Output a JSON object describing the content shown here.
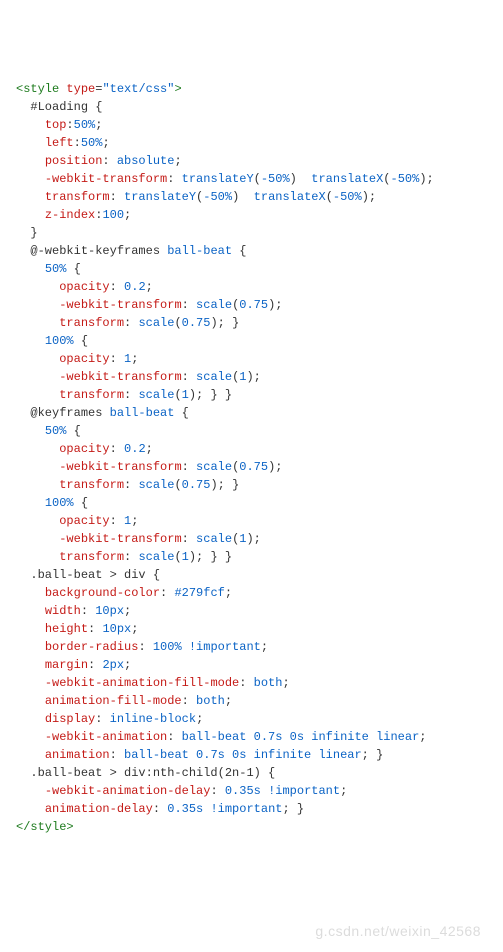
{
  "watermark": "g.csdn.net/weixin_42568",
  "code": [
    [
      {
        "t": "<style",
        "c": "tag"
      },
      {
        "t": " ",
        "c": "punct"
      },
      {
        "t": "type",
        "c": "attr"
      },
      {
        "t": "=",
        "c": "punct"
      },
      {
        "t": "\"text/css\"",
        "c": "string"
      },
      {
        "t": ">",
        "c": "tag"
      }
    ],
    [
      {
        "t": "  ",
        "c": "punct"
      },
      {
        "t": "#Loading",
        "c": "sel"
      },
      {
        "t": " {",
        "c": "punct"
      }
    ],
    [
      {
        "t": "    ",
        "c": "punct"
      },
      {
        "t": "top",
        "c": "prop"
      },
      {
        "t": ":",
        "c": "punct"
      },
      {
        "t": "50%",
        "c": "val"
      },
      {
        "t": ";",
        "c": "punct"
      }
    ],
    [
      {
        "t": "    ",
        "c": "punct"
      },
      {
        "t": "left",
        "c": "prop"
      },
      {
        "t": ":",
        "c": "punct"
      },
      {
        "t": "50%",
        "c": "val"
      },
      {
        "t": ";",
        "c": "punct"
      }
    ],
    [
      {
        "t": "    ",
        "c": "punct"
      },
      {
        "t": "position",
        "c": "prop"
      },
      {
        "t": ": ",
        "c": "punct"
      },
      {
        "t": "absolute",
        "c": "val"
      },
      {
        "t": ";",
        "c": "punct"
      }
    ],
    [
      {
        "t": "    ",
        "c": "punct"
      },
      {
        "t": "-webkit-transform",
        "c": "prop"
      },
      {
        "t": ": ",
        "c": "punct"
      },
      {
        "t": "translateY",
        "c": "val"
      },
      {
        "t": "(",
        "c": "punct"
      },
      {
        "t": "-50%",
        "c": "num"
      },
      {
        "t": ")  ",
        "c": "punct"
      },
      {
        "t": "translateX",
        "c": "val"
      },
      {
        "t": "(",
        "c": "punct"
      },
      {
        "t": "-50%",
        "c": "num"
      },
      {
        "t": ");",
        "c": "punct"
      }
    ],
    [
      {
        "t": "    ",
        "c": "punct"
      },
      {
        "t": "transform",
        "c": "prop"
      },
      {
        "t": ": ",
        "c": "punct"
      },
      {
        "t": "translateY",
        "c": "val"
      },
      {
        "t": "(",
        "c": "punct"
      },
      {
        "t": "-50%",
        "c": "num"
      },
      {
        "t": ")  ",
        "c": "punct"
      },
      {
        "t": "translateX",
        "c": "val"
      },
      {
        "t": "(",
        "c": "punct"
      },
      {
        "t": "-50%",
        "c": "num"
      },
      {
        "t": ");",
        "c": "punct"
      }
    ],
    [
      {
        "t": "    ",
        "c": "punct"
      },
      {
        "t": "z-index",
        "c": "prop"
      },
      {
        "t": ":",
        "c": "punct"
      },
      {
        "t": "100",
        "c": "val"
      },
      {
        "t": ";",
        "c": "punct"
      }
    ],
    [
      {
        "t": "  }",
        "c": "punct"
      }
    ],
    [
      {
        "t": "  ",
        "c": "punct"
      },
      {
        "t": "@-webkit-keyframes",
        "c": "sel"
      },
      {
        "t": " ",
        "c": "punct"
      },
      {
        "t": "ball-beat",
        "c": "val"
      },
      {
        "t": " {",
        "c": "punct"
      }
    ],
    [
      {
        "t": "    ",
        "c": "punct"
      },
      {
        "t": "50%",
        "c": "pct"
      },
      {
        "t": " {",
        "c": "punct"
      }
    ],
    [
      {
        "t": "      ",
        "c": "punct"
      },
      {
        "t": "opacity",
        "c": "prop"
      },
      {
        "t": ": ",
        "c": "punct"
      },
      {
        "t": "0.2",
        "c": "val"
      },
      {
        "t": ";",
        "c": "punct"
      }
    ],
    [
      {
        "t": "      ",
        "c": "punct"
      },
      {
        "t": "-webkit-transform",
        "c": "prop"
      },
      {
        "t": ": ",
        "c": "punct"
      },
      {
        "t": "scale",
        "c": "val"
      },
      {
        "t": "(",
        "c": "punct"
      },
      {
        "t": "0.75",
        "c": "num"
      },
      {
        "t": ");",
        "c": "punct"
      }
    ],
    [
      {
        "t": "      ",
        "c": "punct"
      },
      {
        "t": "transform",
        "c": "prop"
      },
      {
        "t": ": ",
        "c": "punct"
      },
      {
        "t": "scale",
        "c": "val"
      },
      {
        "t": "(",
        "c": "punct"
      },
      {
        "t": "0.75",
        "c": "num"
      },
      {
        "t": "); }",
        "c": "punct"
      }
    ],
    [
      {
        "t": "    ",
        "c": "punct"
      },
      {
        "t": "100%",
        "c": "pct"
      },
      {
        "t": " {",
        "c": "punct"
      }
    ],
    [
      {
        "t": "      ",
        "c": "punct"
      },
      {
        "t": "opacity",
        "c": "prop"
      },
      {
        "t": ": ",
        "c": "punct"
      },
      {
        "t": "1",
        "c": "val"
      },
      {
        "t": ";",
        "c": "punct"
      }
    ],
    [
      {
        "t": "      ",
        "c": "punct"
      },
      {
        "t": "-webkit-transform",
        "c": "prop"
      },
      {
        "t": ": ",
        "c": "punct"
      },
      {
        "t": "scale",
        "c": "val"
      },
      {
        "t": "(",
        "c": "punct"
      },
      {
        "t": "1",
        "c": "num"
      },
      {
        "t": ");",
        "c": "punct"
      }
    ],
    [
      {
        "t": "      ",
        "c": "punct"
      },
      {
        "t": "transform",
        "c": "prop"
      },
      {
        "t": ": ",
        "c": "punct"
      },
      {
        "t": "scale",
        "c": "val"
      },
      {
        "t": "(",
        "c": "punct"
      },
      {
        "t": "1",
        "c": "num"
      },
      {
        "t": "); } }",
        "c": "punct"
      }
    ],
    [
      {
        "t": "  ",
        "c": "punct"
      },
      {
        "t": "@keyframes",
        "c": "sel"
      },
      {
        "t": " ",
        "c": "punct"
      },
      {
        "t": "ball-beat",
        "c": "val"
      },
      {
        "t": " {",
        "c": "punct"
      }
    ],
    [
      {
        "t": "    ",
        "c": "punct"
      },
      {
        "t": "50%",
        "c": "pct"
      },
      {
        "t": " {",
        "c": "punct"
      }
    ],
    [
      {
        "t": "      ",
        "c": "punct"
      },
      {
        "t": "opacity",
        "c": "prop"
      },
      {
        "t": ": ",
        "c": "punct"
      },
      {
        "t": "0.2",
        "c": "val"
      },
      {
        "t": ";",
        "c": "punct"
      }
    ],
    [
      {
        "t": "      ",
        "c": "punct"
      },
      {
        "t": "-webkit-transform",
        "c": "prop"
      },
      {
        "t": ": ",
        "c": "punct"
      },
      {
        "t": "scale",
        "c": "val"
      },
      {
        "t": "(",
        "c": "punct"
      },
      {
        "t": "0.75",
        "c": "num"
      },
      {
        "t": ");",
        "c": "punct"
      }
    ],
    [
      {
        "t": "      ",
        "c": "punct"
      },
      {
        "t": "transform",
        "c": "prop"
      },
      {
        "t": ": ",
        "c": "punct"
      },
      {
        "t": "scale",
        "c": "val"
      },
      {
        "t": "(",
        "c": "punct"
      },
      {
        "t": "0.75",
        "c": "num"
      },
      {
        "t": "); }",
        "c": "punct"
      }
    ],
    [
      {
        "t": "    ",
        "c": "punct"
      },
      {
        "t": "100%",
        "c": "pct"
      },
      {
        "t": " {",
        "c": "punct"
      }
    ],
    [
      {
        "t": "      ",
        "c": "punct"
      },
      {
        "t": "opacity",
        "c": "prop"
      },
      {
        "t": ": ",
        "c": "punct"
      },
      {
        "t": "1",
        "c": "val"
      },
      {
        "t": ";",
        "c": "punct"
      }
    ],
    [
      {
        "t": "      ",
        "c": "punct"
      },
      {
        "t": "-webkit-transform",
        "c": "prop"
      },
      {
        "t": ": ",
        "c": "punct"
      },
      {
        "t": "scale",
        "c": "val"
      },
      {
        "t": "(",
        "c": "punct"
      },
      {
        "t": "1",
        "c": "num"
      },
      {
        "t": ");",
        "c": "punct"
      }
    ],
    [
      {
        "t": "      ",
        "c": "punct"
      },
      {
        "t": "transform",
        "c": "prop"
      },
      {
        "t": ": ",
        "c": "punct"
      },
      {
        "t": "scale",
        "c": "val"
      },
      {
        "t": "(",
        "c": "punct"
      },
      {
        "t": "1",
        "c": "num"
      },
      {
        "t": "); } }",
        "c": "punct"
      }
    ],
    [
      {
        "t": "  ",
        "c": "punct"
      },
      {
        "t": ".ball-beat > div",
        "c": "sel"
      },
      {
        "t": " {",
        "c": "punct"
      }
    ],
    [
      {
        "t": "    ",
        "c": "punct"
      },
      {
        "t": "background-color",
        "c": "prop"
      },
      {
        "t": ": ",
        "c": "punct"
      },
      {
        "t": "#279fcf",
        "c": "val"
      },
      {
        "t": ";",
        "c": "punct"
      }
    ],
    [
      {
        "t": "    ",
        "c": "punct"
      },
      {
        "t": "width",
        "c": "prop"
      },
      {
        "t": ": ",
        "c": "punct"
      },
      {
        "t": "10px",
        "c": "val"
      },
      {
        "t": ";",
        "c": "punct"
      }
    ],
    [
      {
        "t": "    ",
        "c": "punct"
      },
      {
        "t": "height",
        "c": "prop"
      },
      {
        "t": ": ",
        "c": "punct"
      },
      {
        "t": "10px",
        "c": "val"
      },
      {
        "t": ";",
        "c": "punct"
      }
    ],
    [
      {
        "t": "    ",
        "c": "punct"
      },
      {
        "t": "border-radius",
        "c": "prop"
      },
      {
        "t": ": ",
        "c": "punct"
      },
      {
        "t": "100% !important",
        "c": "val"
      },
      {
        "t": ";",
        "c": "punct"
      }
    ],
    [
      {
        "t": "    ",
        "c": "punct"
      },
      {
        "t": "margin",
        "c": "prop"
      },
      {
        "t": ": ",
        "c": "punct"
      },
      {
        "t": "2px",
        "c": "val"
      },
      {
        "t": ";",
        "c": "punct"
      }
    ],
    [
      {
        "t": "    ",
        "c": "punct"
      },
      {
        "t": "-webkit-animation-fill-mode",
        "c": "prop"
      },
      {
        "t": ": ",
        "c": "punct"
      },
      {
        "t": "both",
        "c": "val"
      },
      {
        "t": ";",
        "c": "punct"
      }
    ],
    [
      {
        "t": "    ",
        "c": "punct"
      },
      {
        "t": "animation-fill-mode",
        "c": "prop"
      },
      {
        "t": ": ",
        "c": "punct"
      },
      {
        "t": "both",
        "c": "val"
      },
      {
        "t": ";",
        "c": "punct"
      }
    ],
    [
      {
        "t": "    ",
        "c": "punct"
      },
      {
        "t": "display",
        "c": "prop"
      },
      {
        "t": ": ",
        "c": "punct"
      },
      {
        "t": "inline-block",
        "c": "val"
      },
      {
        "t": ";",
        "c": "punct"
      }
    ],
    [
      {
        "t": "    ",
        "c": "punct"
      },
      {
        "t": "-webkit-animation",
        "c": "prop"
      },
      {
        "t": ": ",
        "c": "punct"
      },
      {
        "t": "ball-beat 0.7s 0s infinite linear",
        "c": "val"
      },
      {
        "t": ";",
        "c": "punct"
      }
    ],
    [
      {
        "t": "    ",
        "c": "punct"
      },
      {
        "t": "animation",
        "c": "prop"
      },
      {
        "t": ": ",
        "c": "punct"
      },
      {
        "t": "ball-beat 0.7s 0s infinite linear",
        "c": "val"
      },
      {
        "t": "; }",
        "c": "punct"
      }
    ],
    [
      {
        "t": "  ",
        "c": "punct"
      },
      {
        "t": ".ball-beat > div:nth-child(2n-1)",
        "c": "sel"
      },
      {
        "t": " {",
        "c": "punct"
      }
    ],
    [
      {
        "t": "    ",
        "c": "punct"
      },
      {
        "t": "-webkit-animation-delay",
        "c": "prop"
      },
      {
        "t": ": ",
        "c": "punct"
      },
      {
        "t": "0.35s !important",
        "c": "val"
      },
      {
        "t": ";",
        "c": "punct"
      }
    ],
    [
      {
        "t": "    ",
        "c": "punct"
      },
      {
        "t": "animation-delay",
        "c": "prop"
      },
      {
        "t": ": ",
        "c": "punct"
      },
      {
        "t": "0.35s !important",
        "c": "val"
      },
      {
        "t": "; }",
        "c": "punct"
      }
    ],
    [
      {
        "t": "</style>",
        "c": "tag"
      }
    ]
  ]
}
